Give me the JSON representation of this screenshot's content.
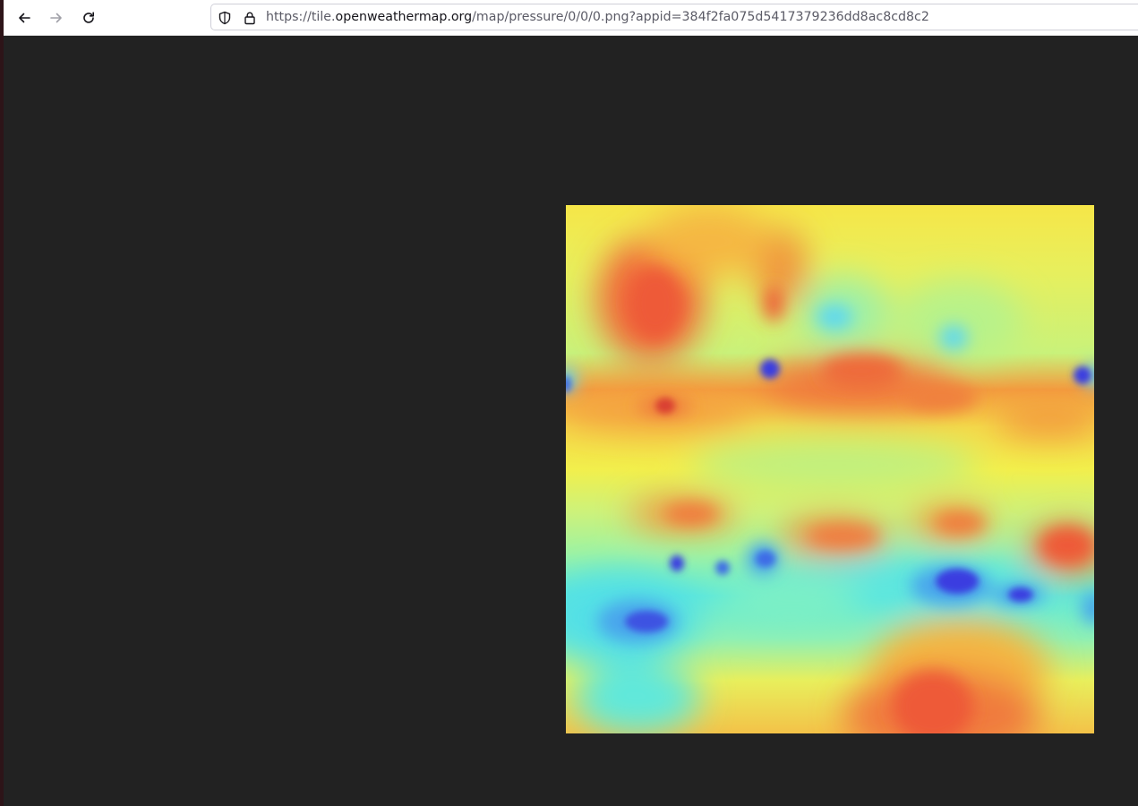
{
  "browser": {
    "back_icon": "arrow-left-icon",
    "forward_icon": "arrow-right-icon",
    "reload_icon": "reload-icon",
    "shield_icon": "shield-icon",
    "lock_icon": "lock-icon",
    "url": {
      "prefix": "https://tile.",
      "domain": "openweathermap.org",
      "path": "/map/pressure/0/0/0.png?appid=384f2fa075d5417379236dd8ac8cd8c2"
    }
  },
  "content": {
    "image_description": "pressure-map-tile",
    "palette": {
      "background": "#222222",
      "high_pressure": "#f05a3a",
      "mid_pressure": "#f7eb48",
      "low_pressure": "#52e6e6",
      "very_low_pressure": "#3b3ee0"
    }
  }
}
